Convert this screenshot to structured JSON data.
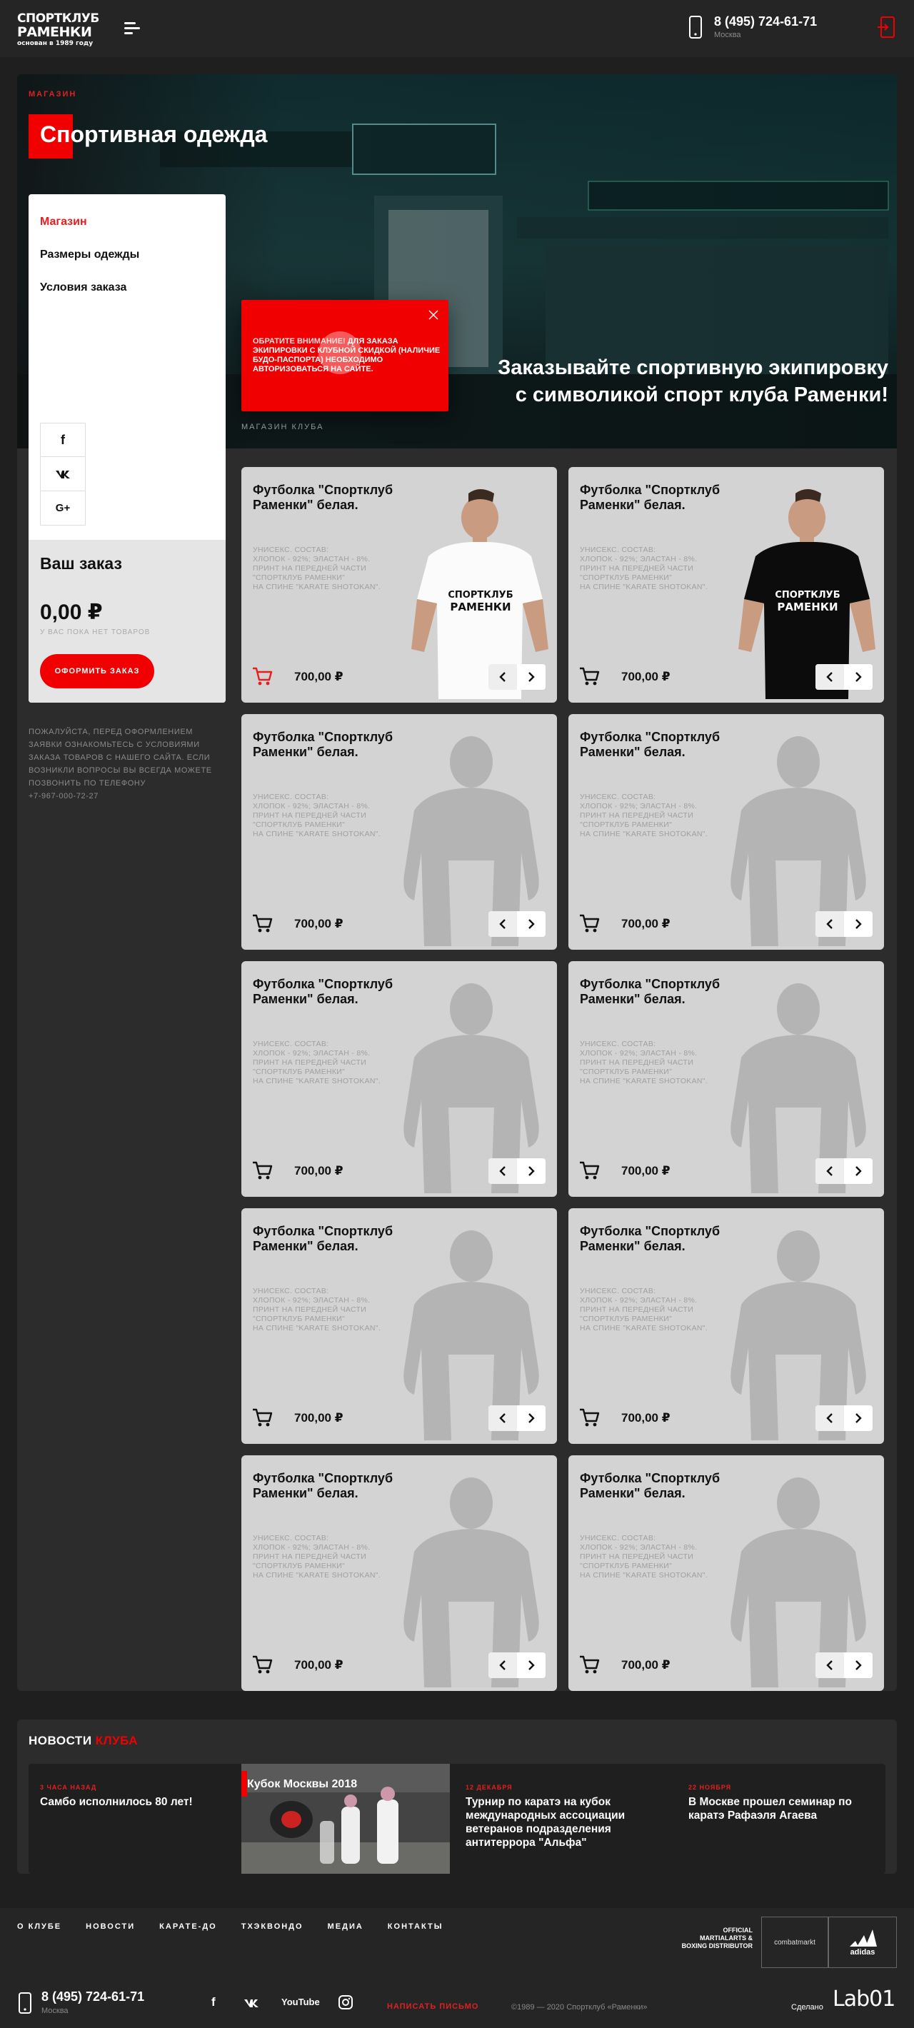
{
  "header": {
    "logo_line1": "СПОРТКЛУБ",
    "logo_line2": "РАМЕНКИ",
    "logo_line3": "основан в 1989 году",
    "phone": "8 (495) 724-61-71",
    "city": "Москва"
  },
  "hero": {
    "breadcrumb": "МАГАЗИН",
    "title": "Спортивная одежда",
    "tagline": "Заказывайте спортивную экипировку с символикой спорт клуба Раменки!",
    "subcaption": "МАГАЗИН КЛУБА",
    "notice_bold": "ОБРАТИТЕ ВНИМАНИЕ!",
    "notice_text": " ДЛЯ ЗАКАЗА ЭКИПИРОВКИ С КЛУБНОЙ СКИДКОЙ (НАЛИЧИЕ БУДО-ПАСПОРТА) НЕОБХОДИМО АВТОРИЗОВАТЬСЯ НА САЙТЕ."
  },
  "sidebar": {
    "menu": [
      {
        "label": "Магазин",
        "active": true
      },
      {
        "label": "Размеры одежды",
        "active": false
      },
      {
        "label": "Условия заказа",
        "active": false
      }
    ],
    "socials": [
      "f",
      "vk",
      "G+"
    ],
    "order_title": "Ваш заказ",
    "order_sum": "0,00 ₽",
    "order_empty": "У ВАС ПОКА НЕТ ТОВАРОВ",
    "order_button": "ОФОРМИТЬ ЗАКАЗ",
    "note": "ПОЖАЛУЙСТА, ПЕРЕД ОФОРМЛЕНИЕМ ЗАЯВКИ ОЗНАКОМЬТЕСЬ С УСЛОВИЯМИ ЗАКАЗА ТОВАРОВ С НАШЕГО САЙТА. ЕСЛИ ВОЗНИКЛИ ВОПРОСЫ ВЫ ВСЕГДА МОЖЕТЕ ПОЗВОНИТЬ ПО ТЕЛЕФОНУ",
    "note_phone": "+7-967-000-72-27"
  },
  "products": [
    {
      "title": "Футболка \"Спортклуб Раменки\" белая.",
      "desc": "УНИСЕКС. СОСТАВ:\nХЛОПОК - 92%; ЭЛАСТАН - 8%.\nПРИНТ НА ПЕРЕДНЕЙ ЧАСТИ\n\"СПОРТКЛУБ РАМЕНКИ\"\nНА СПИНЕ \"KARATE SHOTOKAN\".",
      "price": "700,00 ₽",
      "image": "white-tshirt",
      "cart_active": true,
      "shirt_label": "СПОРТКЛУБ РАМЕНКИ"
    },
    {
      "title": "Футболка \"Спортклуб Раменки\" белая.",
      "desc": "УНИСЕКС. СОСТАВ:\nХЛОПОК - 92%; ЭЛАСТАН - 8%.\nПРИНТ НА ПЕРЕДНЕЙ ЧАСТИ\n\"СПОРТКЛУБ РАМЕНКИ\"\nНА СПИНЕ \"KARATE SHOTOKAN\".",
      "price": "700,00 ₽",
      "image": "black-tshirt",
      "cart_active": false,
      "shirt_label": "СПОРТКЛУБ РАМЕНКИ"
    },
    {
      "title": "Футболка \"Спортклуб Раменки\" белая.",
      "desc": "УНИСЕКС. СОСТАВ:\nХЛОПОК - 92%; ЭЛАСТАН - 8%.\nПРИНТ НА ПЕРЕДНЕЙ ЧАСТИ\n\"СПОРТКЛУБ РАМЕНКИ\"\nНА СПИНЕ \"KARATE SHOTOKAN\".",
      "price": "700,00 ₽",
      "image": "silhouette",
      "cart_active": false
    },
    {
      "title": "Футболка \"Спортклуб Раменки\" белая.",
      "desc": "УНИСЕКС. СОСТАВ:\nХЛОПОК - 92%; ЭЛАСТАН - 8%.\nПРИНТ НА ПЕРЕДНЕЙ ЧАСТИ\n\"СПОРТКЛУБ РАМЕНКИ\"\nНА СПИНЕ \"KARATE SHOTOKAN\".",
      "price": "700,00 ₽",
      "image": "silhouette",
      "cart_active": false
    },
    {
      "title": "Футболка \"Спортклуб Раменки\" белая.",
      "desc": "УНИСЕКС. СОСТАВ:\nХЛОПОК - 92%; ЭЛАСТАН - 8%.\nПРИНТ НА ПЕРЕДНЕЙ ЧАСТИ\n\"СПОРТКЛУБ РАМЕНКИ\"\nНА СПИНЕ \"KARATE SHOTOKAN\".",
      "price": "700,00 ₽",
      "image": "silhouette",
      "cart_active": false
    },
    {
      "title": "Футболка \"Спортклуб Раменки\" белая.",
      "desc": "УНИСЕКС. СОСТАВ:\nХЛОПОК - 92%; ЭЛАСТАН - 8%.\nПРИНТ НА ПЕРЕДНЕЙ ЧАСТИ\n\"СПОРТКЛУБ РАМЕНКИ\"\nНА СПИНЕ \"KARATE SHOTOKAN\".",
      "price": "700,00 ₽",
      "image": "silhouette",
      "cart_active": false
    },
    {
      "title": "Футболка \"Спортклуб Раменки\" белая.",
      "desc": "УНИСЕКС. СОСТАВ:\nХЛОПОК - 92%; ЭЛАСТАН - 8%.\nПРИНТ НА ПЕРЕДНЕЙ ЧАСТИ\n\"СПОРТКЛУБ РАМЕНКИ\"\nНА СПИНЕ \"KARATE SHOTOKAN\".",
      "price": "700,00 ₽",
      "image": "silhouette",
      "cart_active": false
    },
    {
      "title": "Футболка \"Спортклуб Раменки\" белая.",
      "desc": "УНИСЕКС. СОСТАВ:\nХЛОПОК - 92%; ЭЛАСТАН - 8%.\nПРИНТ НА ПЕРЕДНЕЙ ЧАСТИ\n\"СПОРТКЛУБ РАМЕНКИ\"\nНА СПИНЕ \"KARATE SHOTOKAN\".",
      "price": "700,00 ₽",
      "image": "silhouette",
      "cart_active": false
    },
    {
      "title": "Футболка \"Спортклуб Раменки\" белая.",
      "desc": "УНИСЕКС. СОСТАВ:\nХЛОПОК - 92%; ЭЛАСТАН - 8%.\nПРИНТ НА ПЕРЕДНЕЙ ЧАСТИ\n\"СПОРТКЛУБ РАМЕНКИ\"\nНА СПИНЕ \"KARATE SHOTOKAN\".",
      "price": "700,00 ₽",
      "image": "silhouette",
      "cart_active": false
    },
    {
      "title": "Футболка \"Спортклуб Раменки\" белая.",
      "desc": "УНИСЕКС. СОСТАВ:\nХЛОПОК - 92%; ЭЛАСТАН - 8%.\nПРИНТ НА ПЕРЕДНЕЙ ЧАСТИ\n\"СПОРТКЛУБ РАМЕНКИ\"\nНА СПИНЕ \"KARATE SHOTOKAN\".",
      "price": "700,00 ₽",
      "image": "silhouette",
      "cart_active": false
    }
  ],
  "news": {
    "title_white": "НОВОСТИ",
    "title_red": "КЛУБА",
    "items": [
      {
        "date": "3 ЧАСА НАЗАД",
        "headline": "Самбо исполнилось 80 лет!"
      },
      {
        "image_label": "Кубок Москвы 2018"
      },
      {
        "date": "12 ДЕКАБРЯ",
        "headline": "Турнир по каратэ на кубок международных ассоциации ветеранов подразделения антитеррора \"Альфа\""
      },
      {
        "date": "22 НОЯБРЯ",
        "headline": "В Москве прошел семинар по каратэ Рафаэля Агаева"
      }
    ]
  },
  "footer": {
    "nav": [
      "О КЛУБЕ",
      "НОВОСТИ",
      "КАРАТЕ-ДО",
      "ТХЭКВОНДО",
      "МЕДИА",
      "КОНТАКТЫ"
    ],
    "partner_text": "OFFICIAL MARTIALARTS & BOXING DISTRIBUTOR",
    "partner1": "combatmarkt",
    "partner2": "adidas",
    "phone": "8 (495) 724-61-71",
    "city": "Москва",
    "socials": [
      "f",
      "vk",
      "YouTube",
      "instagram"
    ],
    "write_link": "НАПИСАТЬ ПИСЬМО",
    "copyright": "©1989 — 2020 Спортклуб «Раменки»",
    "made_by": "Сделано",
    "studio": "Lab01"
  },
  "colors": {
    "accent": "#f00000",
    "bg": "#1f1f1f",
    "panel": "#2c2c2c",
    "card": "#d3d3d3"
  }
}
